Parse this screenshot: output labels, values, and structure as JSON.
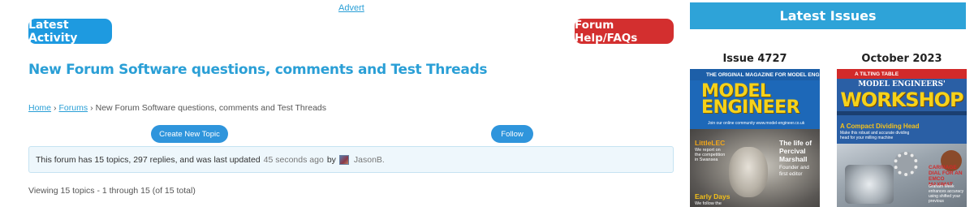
{
  "advert": {
    "label": "Advert"
  },
  "header": {
    "latest_activity_label": "Latest Activity",
    "forum_help_label": "Forum Help/FAQs"
  },
  "page": {
    "title": "New Forum Software questions, comments and Test Threads"
  },
  "breadcrumb": {
    "home": "Home",
    "forums": "Forums",
    "separator": "›",
    "current": "New Forum Software questions, comments and Test Threads"
  },
  "actions": {
    "create_topic_label": "Create New Topic",
    "follow_label": "Follow"
  },
  "forum_info": {
    "text": "This forum has 15 topics, 297 replies, and was last updated",
    "last_updated": "45 seconds ago",
    "by": "by",
    "user": "JasonB."
  },
  "viewing": {
    "text": "Viewing 15 topics - 1 through 15 (of 15 total)"
  },
  "sidebar": {
    "title": "Latest Issues",
    "issues": [
      {
        "label": "Issue 4727",
        "cover": {
          "top_strip": "THE ORIGINAL MAGAZINE FOR MODEL ENGINEERS",
          "logo_line1": "MODEL",
          "logo_line2": "ENGINEER",
          "tagline": "Join our online community www.model-engineer.co.uk",
          "left_head": "LittleLEC",
          "left_text": "We report on the competition in Swansea",
          "right_head": "The life of Percival Marshall",
          "right_text": "Founder and first editor",
          "bottom_head": "Early Days",
          "bottom_text": "We follow the"
        }
      },
      {
        "label": "October 2023",
        "cover": {
          "top_strip": "A TILTING TABLE",
          "masthead_small": "MODEL ENGINEERS'",
          "masthead_big": "WORKSHOP",
          "feature_head": "A Compact Dividing Head",
          "feature_text": "Make this robust and accurate dividing head for your milling machine",
          "side_head": "CARRIAGE DIAL FOR AN EMCO MAXIMAT",
          "side_text": "Graham Meek enhances accuracy using shifted your previous"
        }
      }
    ]
  },
  "colors": {
    "accent_blue": "#2a9fd6",
    "button_blue": "#1e9ae0",
    "button_red": "#d32f2f",
    "header_bar": "#2ea3d8"
  }
}
